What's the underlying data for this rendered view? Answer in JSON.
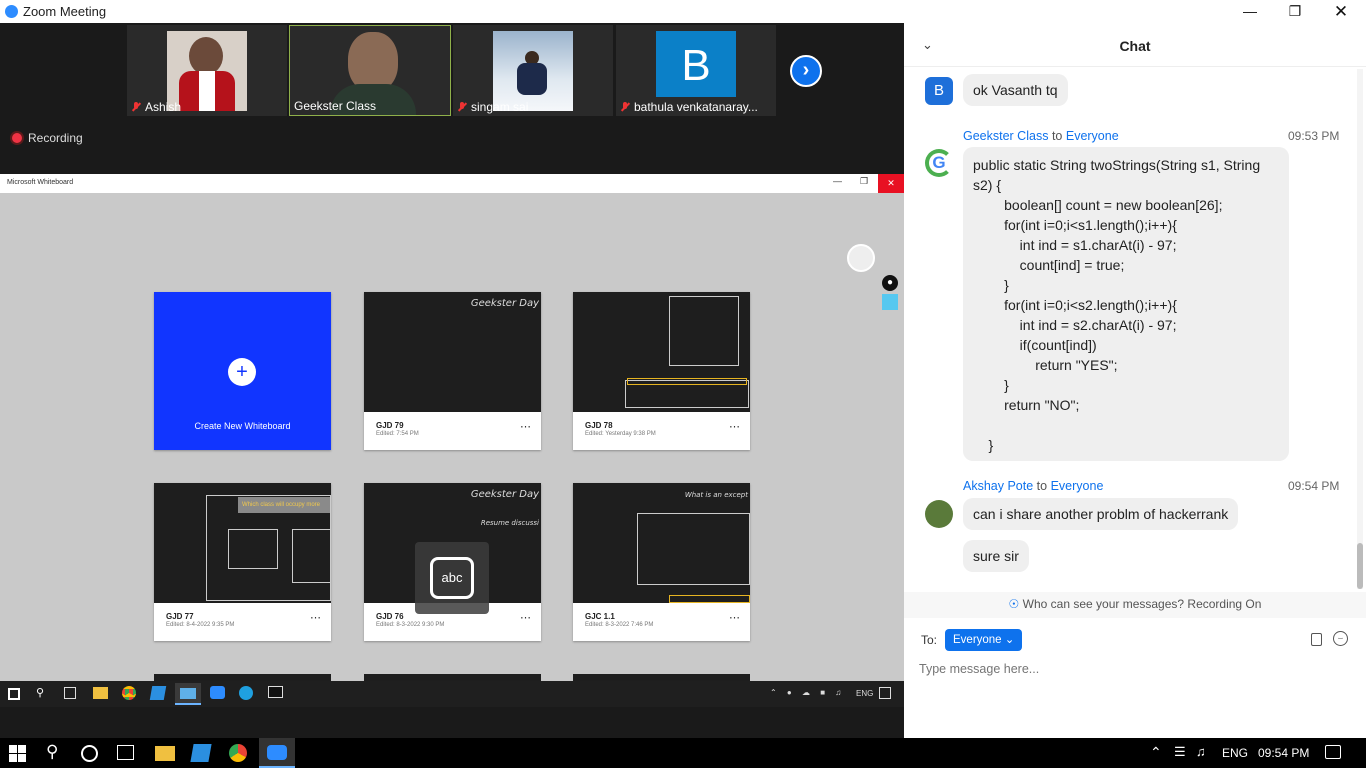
{
  "window": {
    "title": "Zoom Meeting"
  },
  "participants": [
    {
      "name": "Ashish",
      "muted": true
    },
    {
      "name": "Geekster Class",
      "muted": false
    },
    {
      "name": "singam sai",
      "muted": true
    },
    {
      "name": "bathula venkatanaray...",
      "muted": true,
      "initial": "B"
    }
  ],
  "recording": {
    "label": "Recording"
  },
  "whiteboard": {
    "app_title": "Microsoft Whiteboard",
    "create_label": "Create New Whiteboard",
    "cards": [
      {
        "name": "GJD 79",
        "date": "Edited: 7:54 PM",
        "thumb_text": "Geekster Day"
      },
      {
        "name": "GJD 78",
        "date": "Edited: Yesterday 9:38 PM"
      },
      {
        "name": "GJD 77",
        "date": "Edited: 8-4-2022 9:35 PM",
        "thumb_text": "Which class will occupy more"
      },
      {
        "name": "GJD 76",
        "date": "Edited: 8-3-2022 9:30 PM",
        "thumb_text": "Geekster Day",
        "thumb_sub": "Resume discussi"
      },
      {
        "name": "GJC 1.1",
        "date": "Edited: 8-3-2022 7:46 PM",
        "thumb_text": "What is an except"
      }
    ],
    "abc_label": "abc",
    "tray_lang": "ENG"
  },
  "chat": {
    "title": "Chat",
    "messages": [
      {
        "initial": "B",
        "text": "ok Vasanth tq"
      },
      {
        "sender": "Geekster Class",
        "to_word": "to",
        "to": "Everyone",
        "time": "09:53 PM",
        "code": [
          "public static String twoStrings(String s1, String",
          "s2) {",
          "        boolean[] count = new boolean[26];",
          "        for(int i=0;i<s1.length();i++){",
          "            int ind = s1.charAt(i) - 97;",
          "            count[ind] = true;",
          "        }",
          "        for(int i=0;i<s2.length();i++){",
          "            int ind = s2.charAt(i) - 97;",
          "            if(count[ind])",
          "                return \"YES\";",
          "        }",
          "        return \"NO\";",
          "",
          "    }"
        ]
      },
      {
        "sender": "Akshay Pote",
        "to_word": "to",
        "to": "Everyone",
        "time": "09:54 PM",
        "texts": [
          "can i share another problm of hackerrank",
          "sure sir"
        ]
      }
    ],
    "visibility_note": "Who can see your messages? Recording On",
    "to_label": "To:",
    "recipient": "Everyone",
    "input_placeholder": "Type message here..."
  },
  "os_taskbar": {
    "lang": "ENG",
    "clock": "09:54 PM"
  },
  "colors": {
    "zoom_blue": "#0e72ed",
    "whiteboard_blue": "#1135ff"
  }
}
